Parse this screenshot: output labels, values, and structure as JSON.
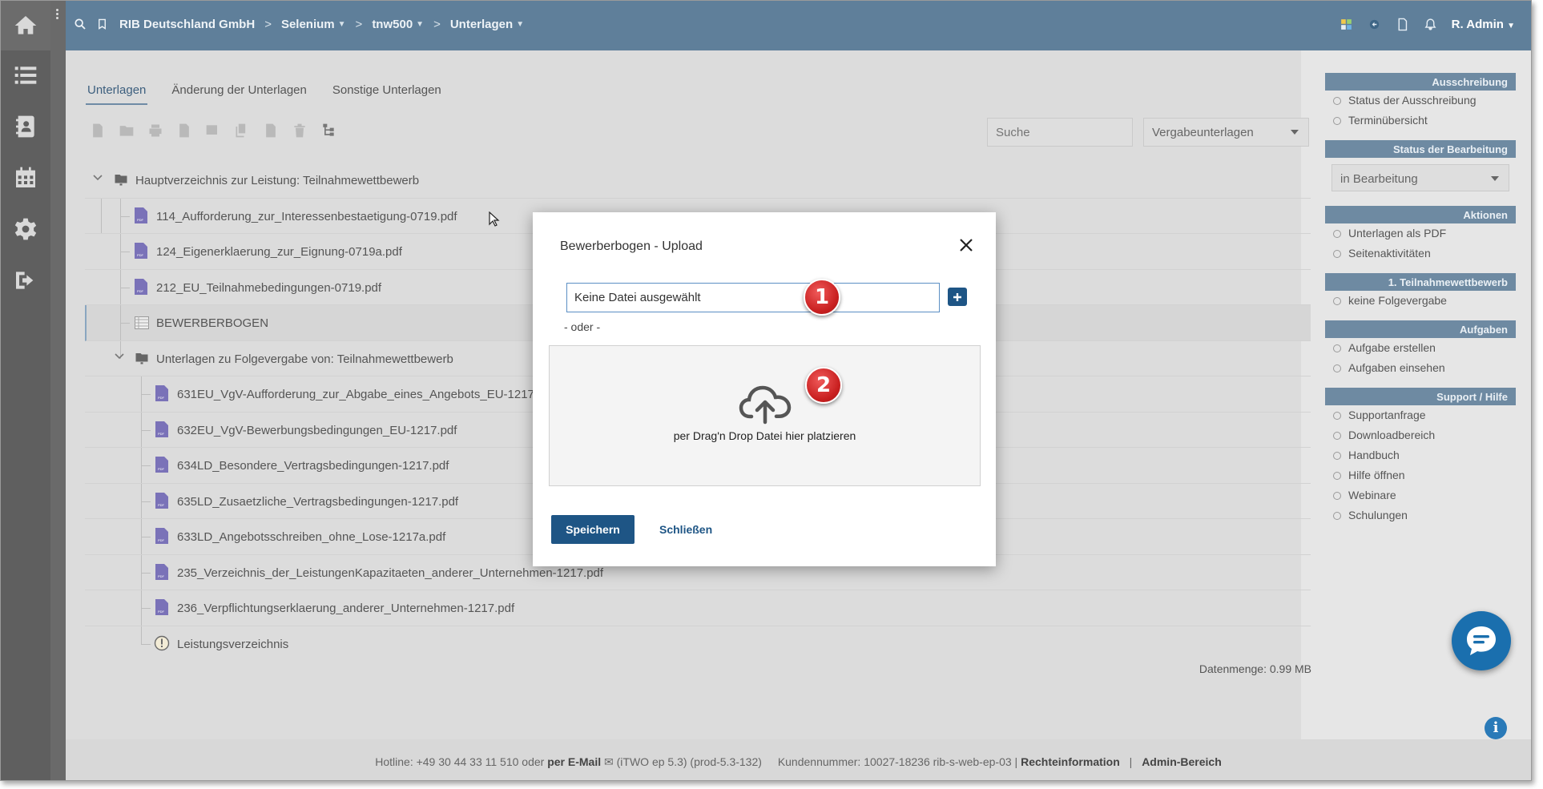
{
  "topbar": {
    "breadcrumbs": [
      {
        "label": "RIB Deutschland GmbH",
        "dropdown": false
      },
      {
        "label": "Selenium",
        "dropdown": true
      },
      {
        "label": "tnw500",
        "dropdown": true
      },
      {
        "label": "Unterlagen",
        "dropdown": true
      }
    ],
    "user": "R. Admin"
  },
  "tabs": [
    "Unterlagen",
    "Änderung der Unterlagen",
    "Sonstige Unterlagen"
  ],
  "search": {
    "placeholder": "Suche"
  },
  "vergabe_select": {
    "value": "Vergabeunterlagen"
  },
  "tree": [
    {
      "label": "Hauptverzeichnis zur Leistung: Teilnahmewettbewerb",
      "type": "folder"
    },
    {
      "label": "114_Aufforderung_zur_Interessenbestaetigung-0719.pdf",
      "type": "pdf"
    },
    {
      "label": "124_Eigenerklaerung_zur_Eignung-0719a.pdf",
      "type": "pdf"
    },
    {
      "label": "212_EU_Teilnahmebedingungen-0719.pdf",
      "type": "pdf"
    },
    {
      "label": "BEWERBERBOGEN",
      "type": "form"
    },
    {
      "label": "Unterlagen zu Folgevergabe von: Teilnahmewettbewerb",
      "type": "folder"
    },
    {
      "label": "631EU_VgV-Aufforderung_zur_Abgabe_eines_Angebots_EU-1217.pdf",
      "type": "pdf"
    },
    {
      "label": "632EU_VgV-Bewerbungsbedingungen_EU-1217.pdf",
      "type": "pdf"
    },
    {
      "label": "634LD_Besondere_Vertragsbedingungen-1217.pdf",
      "type": "pdf"
    },
    {
      "label": "635LD_Zusaetzliche_Vertragsbedingungen-1217.pdf",
      "type": "pdf"
    },
    {
      "label": "633LD_Angebotsschreiben_ohne_Lose-1217a.pdf",
      "type": "pdf"
    },
    {
      "label": "235_Verzeichnis_der_LeistungenKapazitaeten_anderer_Unternehmen-1217.pdf",
      "type": "pdf"
    },
    {
      "label": "236_Verpflichtungserklaerung_anderer_Unternehmen-1217.pdf",
      "type": "pdf"
    },
    {
      "label": "Leistungsverzeichnis",
      "type": "warning"
    }
  ],
  "datenmenge": "Datenmenge: 0.99 MB",
  "sidebar": {
    "ausschreibung": {
      "header": "Ausschreibung",
      "items": [
        "Status der Ausschreibung",
        "Terminübersicht"
      ]
    },
    "status": {
      "header": "Status der Bearbeitung",
      "value": "in Bearbeitung"
    },
    "aktionen": {
      "header": "Aktionen",
      "items": [
        "Unterlagen als PDF",
        "Seitenaktivitäten"
      ]
    },
    "teilnahme": {
      "header": "1. Teilnahmewettbewerb",
      "items": [
        "keine Folgevergabe"
      ]
    },
    "aufgaben": {
      "header": "Aufgaben",
      "items": [
        "Aufgabe erstellen",
        "Aufgaben einsehen"
      ]
    },
    "support": {
      "header": "Support / Hilfe",
      "items": [
        "Supportanfrage",
        "Downloadbereich",
        "Handbuch",
        "Hilfe öffnen",
        "Webinare",
        "Schulungen"
      ]
    }
  },
  "footer": {
    "hotline": "Hotline: +49 30 44 33 11 510 oder",
    "email": "per E-Mail",
    "version": "(iTWO ep 5.3) (prod-5.3-132)",
    "kundennummer": "Kundennummer: 10027-18236 rib-s-web-ep-03 |",
    "rechte": "Rechteinformation",
    "admin": "Admin-Bereich"
  },
  "modal": {
    "title": "Bewerberbogen - Upload",
    "file_value": "Keine Datei ausgewählt",
    "oder": "- oder -",
    "dropzone_text": "per Drag'n Drop Datei hier platzieren",
    "save_label": "Speichern",
    "close_label": "Schließen"
  },
  "badges": [
    "1",
    "2"
  ],
  "info_label": "i",
  "colors": {
    "topbar": "#5f7f9a",
    "sidebar_header": "#6e8aa2",
    "primary_button": "#1e5585",
    "badge": "#c81f1f"
  }
}
